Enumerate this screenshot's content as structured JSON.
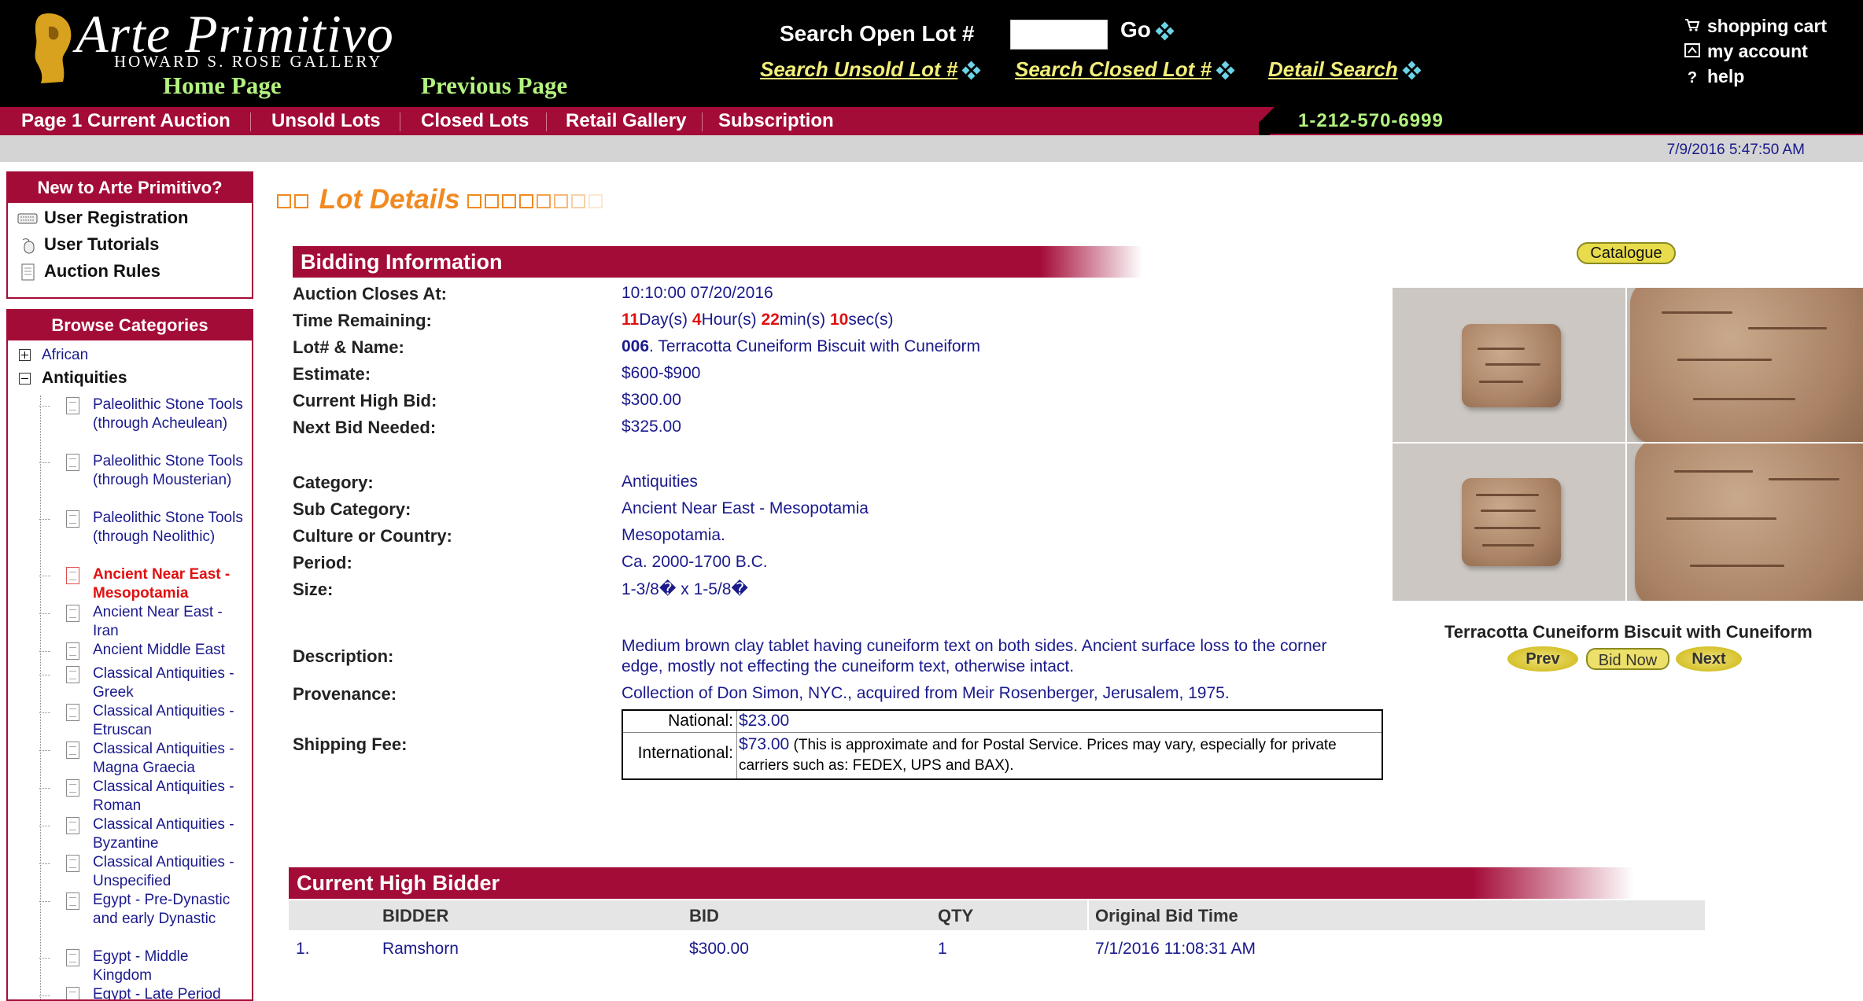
{
  "header": {
    "logo_title": "Arte Primitivo",
    "logo_subtitle": "HOWARD S. ROSE GALLERY",
    "home_link": "Home Page",
    "previous_link": "Previous Page",
    "search_open_label": "Search Open Lot #",
    "search_open_value": "",
    "go_label": "Go",
    "search_unsold_label": "Search Unsold Lot #",
    "search_closed_label": "Search Closed Lot #",
    "detail_search_label": "Detail Search",
    "cart_label": "shopping cart",
    "account_label": "my account",
    "help_label": "help",
    "phone": "1-212-570-6999",
    "datetime": "7/9/2016 5:47:50 AM"
  },
  "nav": {
    "items": [
      "Page 1 Current Auction",
      "Unsold Lots",
      "Closed Lots",
      "Retail Gallery",
      "Subscription"
    ]
  },
  "sidebar": {
    "new_title": "New to Arte Primitivo?",
    "new_items": [
      "User Registration",
      "User Tutorials",
      "Auction Rules"
    ],
    "browse_title": "Browse Categories",
    "tree_top": [
      "African",
      "Antiquities"
    ],
    "leaves": [
      {
        "label": "Paleolithic Stone Tools (through Acheulean)",
        "selected": false
      },
      {
        "label": "Paleolithic Stone Tools (through Mousterian)",
        "selected": false
      },
      {
        "label": "Paleolithic Stone Tools (through Neolithic)",
        "selected": false
      },
      {
        "label": "Ancient Near East - Mesopotamia",
        "selected": true
      },
      {
        "label": "Ancient Near East - Iran",
        "selected": false
      },
      {
        "label": "Ancient Middle East",
        "selected": false
      },
      {
        "label": "Classical Antiquities - Greek",
        "selected": false
      },
      {
        "label": "Classical Antiquities - Etruscan",
        "selected": false
      },
      {
        "label": "Classical Antiquities - Magna Graecia",
        "selected": false
      },
      {
        "label": "Classical Antiquities - Roman",
        "selected": false
      },
      {
        "label": "Classical Antiquities - Byzantine",
        "selected": false
      },
      {
        "label": "Classical Antiquities - Unspecified",
        "selected": false
      },
      {
        "label": "Egypt - Pre-Dynastic and early Dynastic",
        "selected": false
      },
      {
        "label": "Egypt - Middle Kingdom",
        "selected": false
      },
      {
        "label": "Egypt - Late Period",
        "selected": false
      }
    ]
  },
  "lot": {
    "page_title": "Lot Details",
    "bidding_header": "Bidding Information",
    "labels": {
      "closes": "Auction Closes At:",
      "remaining": "Time Remaining:",
      "lot_name": "Lot# & Name:",
      "estimate": "Estimate:",
      "high_bid": "Current High Bid:",
      "next_bid": "Next Bid Needed:",
      "category": "Category:",
      "sub_category": "Sub Category:",
      "culture": "Culture or Country:",
      "period": "Period:",
      "size": "Size:",
      "description": "Description:",
      "provenance": "Provenance:",
      "shipping": "Shipping Fee:"
    },
    "closes_at": "10:10:00 07/20/2016",
    "remaining": {
      "days": "11",
      "days_unit": "Day(s)",
      "hours": "4",
      "hours_unit": "Hour(s)",
      "mins": "22",
      "mins_unit": "min(s)",
      "secs": "10",
      "secs_unit": "sec(s)"
    },
    "lot_number": "006",
    "lot_name": ". Terracotta Cuneiform Biscuit with Cuneiform",
    "estimate": "$600-$900",
    "high_bid": "$300.00",
    "next_bid": "$325.00",
    "category": "Antiquities",
    "sub_category": "Ancient Near East - Mesopotamia",
    "culture": "Mesopotamia.",
    "period": "Ca. 2000-1700 B.C.",
    "size": "1-3/8� x 1-5/8�",
    "description_line1": "Medium brown clay tablet having cuneiform text on both sides. Ancient surface loss to the corner",
    "description_line2": "edge, mostly not effecting the cuneiform text, otherwise intact.",
    "provenance": "Collection of Don Simon, NYC., acquired from Meir Rosenberger, Jerusalem, 1975.",
    "shipping": {
      "national_label": "National:",
      "national_value": "$23.00",
      "international_label": "International:",
      "international_value": "$73.00",
      "international_note_1": " (This is approximate and for Postal Service. Prices may vary, especially for private",
      "international_note_2": "carriers such as: FEDEX, UPS and BAX)."
    }
  },
  "gallery": {
    "catalogue_label": "Catalogue",
    "caption": "Terracotta Cuneiform Biscuit with Cuneiform",
    "prev_label": "Prev",
    "bid_now_label": "Bid Now",
    "next_label": "Next"
  },
  "bidders": {
    "header": "Current High Bidder",
    "columns": [
      "BIDDER",
      "BID",
      "QTY",
      "Original Bid Time"
    ],
    "rows": [
      {
        "rank": "1.",
        "bidder": "Ramshorn",
        "bid": "$300.00",
        "qty": "1",
        "time": "7/1/2016 11:08:31 AM"
      }
    ]
  }
}
